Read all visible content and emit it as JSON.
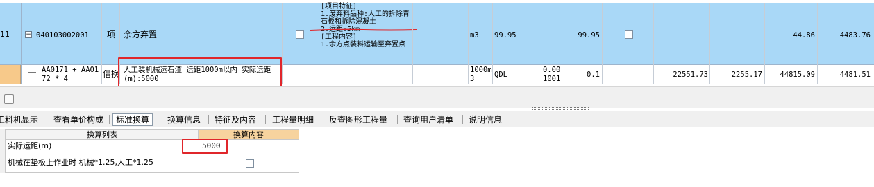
{
  "grid": {
    "row1": {
      "row_num": "11",
      "code": "040103002001",
      "type": "项",
      "name": "余方弃置",
      "feature_text": "[项目特征]\n1.废弃料品种:人工的拆除青石板和拆除混凝土\n2.运距:5km\n[工程内容]\n1.余方点装料运输至弃置点",
      "unit": "m3",
      "qty": "99.95",
      "qty2": "99.95",
      "unit_price": "44.86",
      "total": "4483.76"
    },
    "row2": {
      "code": "AA0171 + AA0172 * 4",
      "type": "借换",
      "name": "人工装机械运石渣 运距1000m以内 实际运距(m):5000",
      "unit": "1000m3",
      "qty_expr": "QDL",
      "content": "0.001001",
      "qty": "0.1",
      "price1": "22551.73",
      "price2": "2255.17",
      "price3": "44815.09",
      "total": "4481.51"
    }
  },
  "tabs": [
    {
      "label": "工料机显示",
      "active": false
    },
    {
      "label": "查看单价构成",
      "active": false
    },
    {
      "label": "标准换算",
      "active": true
    },
    {
      "label": "换算信息",
      "active": false
    },
    {
      "label": "特征及内容",
      "active": false
    },
    {
      "label": "工程量明细",
      "active": false
    },
    {
      "label": "反查图形工程量",
      "active": false
    },
    {
      "label": "查询用户清单",
      "active": false
    },
    {
      "label": "说明信息",
      "active": false
    }
  ],
  "conversion": {
    "col_list": "换算列表",
    "col_content": "换算内容",
    "rows": [
      {
        "label": "实际运距(m)",
        "value": "5000"
      },
      {
        "label": "机械在垫板上作业时 机械*1.25,人工*1.25",
        "value": ""
      }
    ]
  },
  "colors": {
    "selected_row": "#a9d8f7",
    "row_header": "#f7c98a",
    "highlight": "#e0262b"
  }
}
